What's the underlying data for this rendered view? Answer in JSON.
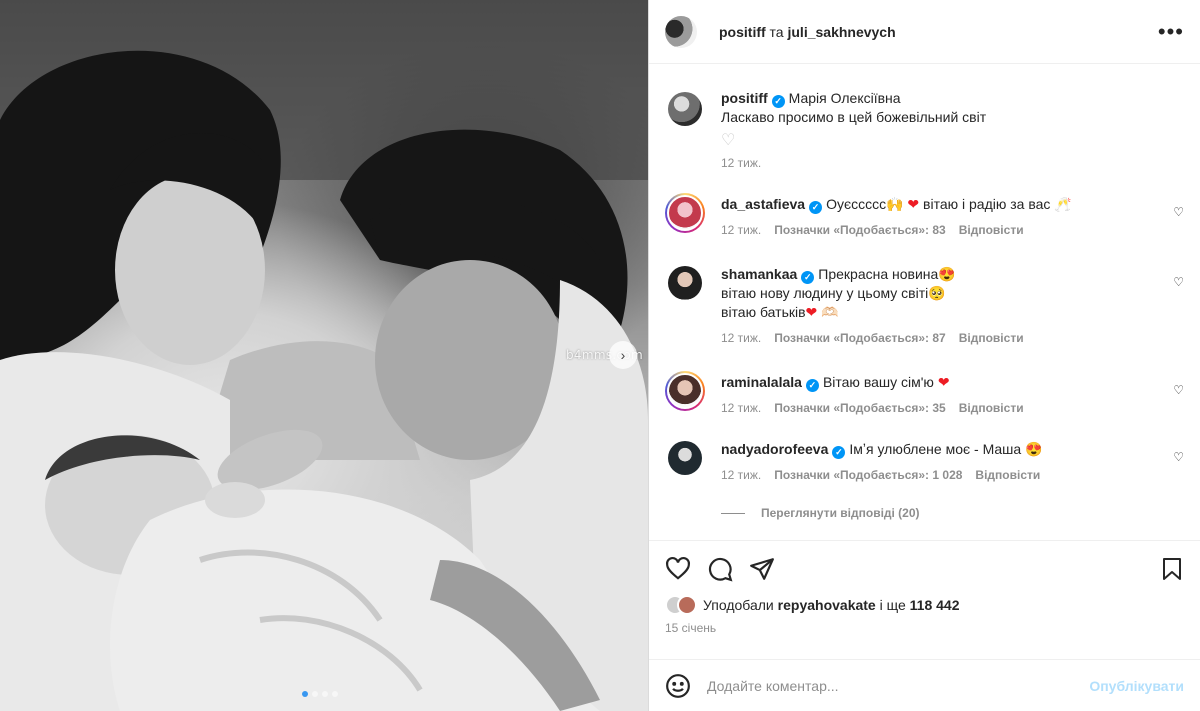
{
  "photo": {
    "watermark": "b4mms.com",
    "carousel": {
      "count": 4,
      "active": 0
    }
  },
  "header": {
    "user1": "positiff",
    "separator": "та",
    "user2": "juli_sakhnevych",
    "more_icon": "more-horizontal-icon"
  },
  "caption": {
    "username": "positiff",
    "line1": "Марія Олексіївна",
    "line2": "Ласкаво просимо в цей божевільний світ",
    "time": "12 тиж."
  },
  "comments": [
    {
      "username": "da_astafieva",
      "text": "Оуєссссс🙌",
      "text_after": "вітаю і радію за вас 🥂",
      "time": "12 тиж.",
      "likes": "Позначки «Подобається»: 83",
      "reply": "Відповісти"
    },
    {
      "username": "shamankaa",
      "text": "Прекрасна новина😍",
      "line2": "вітаю нову людину у цьому світі🥺",
      "line3": "вітаю батьків",
      "line3_after": "🫶🏻",
      "time": "12 тиж.",
      "likes": "Позначки «Подобається»: 87",
      "reply": "Відповісти"
    },
    {
      "username": "raminalalala",
      "text": "Вітаю вашу сім'ю",
      "time": "12 тиж.",
      "likes": "Позначки «Подобається»: 35",
      "reply": "Відповісти"
    },
    {
      "username": "nadyadorofeeva",
      "text": "Імʼя улюблене моє - Маша 😍",
      "time": "12 тиж.",
      "likes": "Позначки «Подобається»: 1 028",
      "reply": "Відповісти"
    }
  ],
  "view_replies": "Переглянути відповіді (20)",
  "likes": {
    "prefix": "Уподобали",
    "user": "repyahovakate",
    "middle": "і ще",
    "count": "118 442"
  },
  "date": "15 січень",
  "add_comment": {
    "placeholder": "Додайте коментар...",
    "post_label": "Опублікувати"
  }
}
